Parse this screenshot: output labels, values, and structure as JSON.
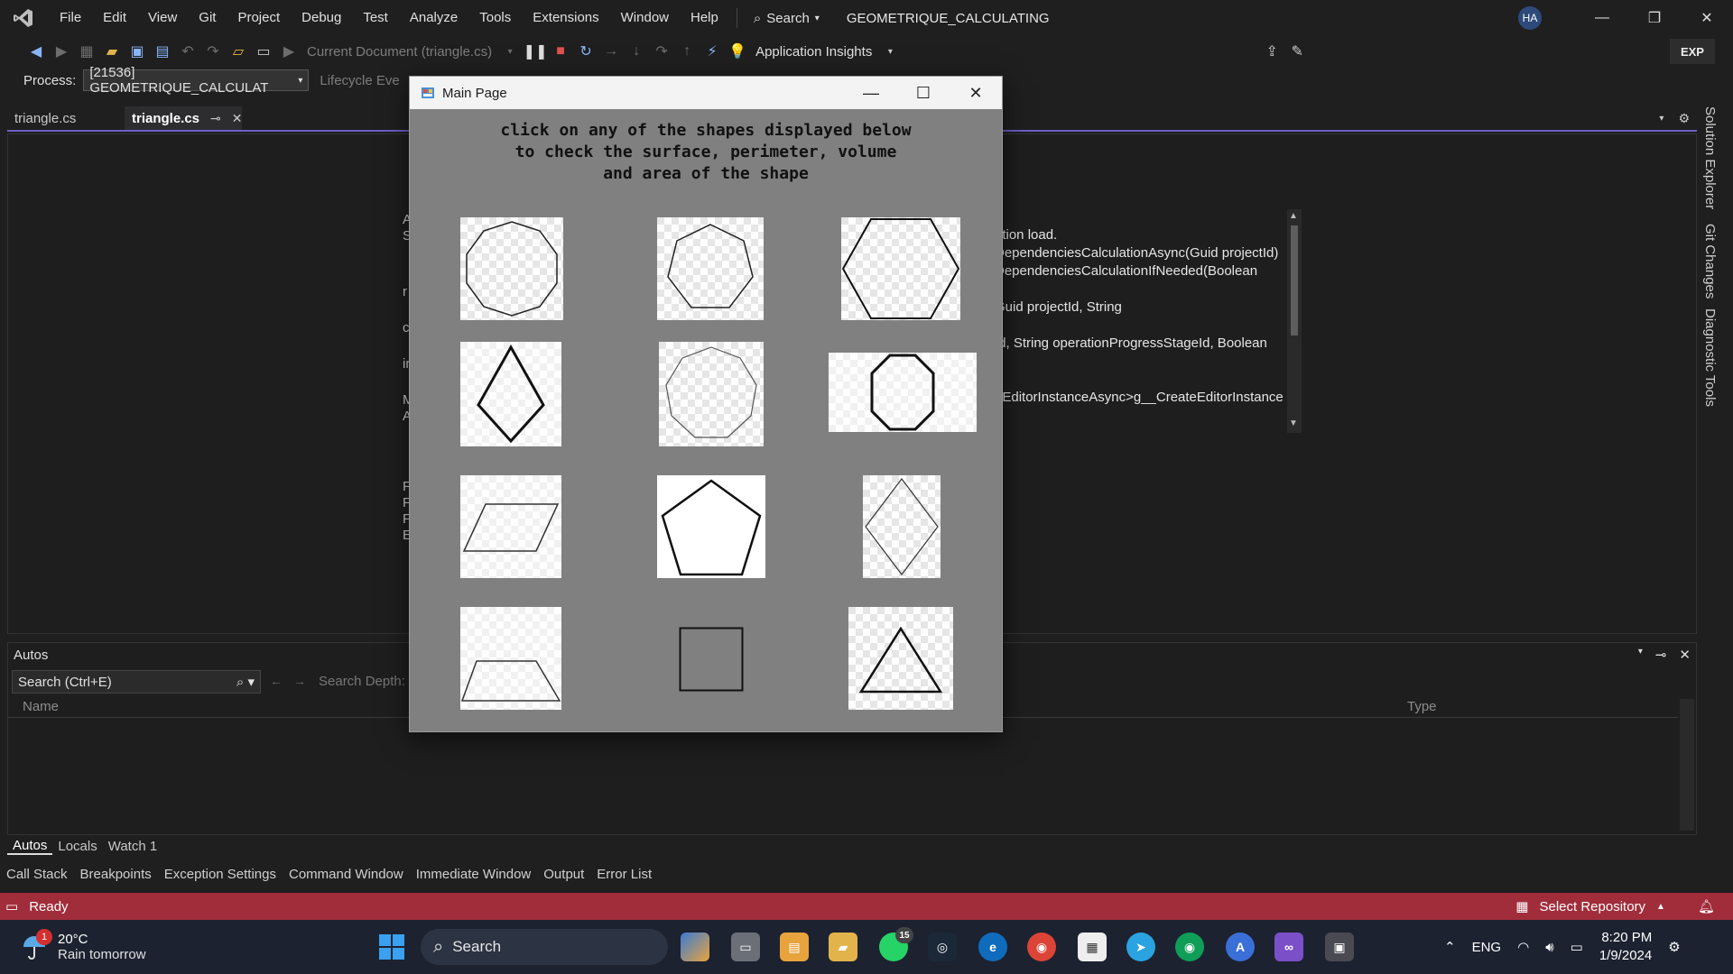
{
  "menu": {
    "items": [
      "File",
      "Edit",
      "View",
      "Git",
      "Project",
      "Debug",
      "Test",
      "Analyze",
      "Tools",
      "Extensions",
      "Window",
      "Help"
    ],
    "search_label": "Search",
    "app_title": "GEOMETRIQUE_CALCULATING",
    "avatar_initials": "HA"
  },
  "toolbar": {
    "run_target": "Current Document (triangle.cs)",
    "insights": "Application Insights",
    "exp_label": "EXP"
  },
  "process": {
    "label": "Process:",
    "value": "[21536] GEOMETRIQUE_CALCULAT",
    "lifecycle": "Lifecycle Eve"
  },
  "tabs": [
    {
      "label": "triangle.cs",
      "active": false
    },
    {
      "label": "triangle.cs",
      "active": true
    }
  ],
  "editor": {
    "gutter_letters": [
      "A",
      "S",
      "r",
      "c",
      "ir",
      "M",
      "A",
      "F",
      "F",
      "F",
      "E"
    ]
  },
  "code_popup": {
    "lines": [
      "ation load.",
      "DependenciesCalculationAsync(Guid projectId)",
      "DependenciesCalculationIfNeeded(Boolean",
      "Guid projectId, String",
      "Id, String operationProgressStageId, Boolean",
      "eEditorInstanceAsync>g__CreateEditorInstance"
    ]
  },
  "side_tabs": [
    "Solution Explorer",
    "Git Changes",
    "Diagnostic Tools"
  ],
  "autos": {
    "title": "Autos",
    "search_placeholder": "Search (Ctrl+E)",
    "search_depth": "Search Depth:",
    "col_name": "Name",
    "col_type": "Type",
    "tabs": [
      "Autos",
      "Locals",
      "Watch 1"
    ]
  },
  "bottom_tabs": [
    "Call Stack",
    "Breakpoints",
    "Exception Settings",
    "Command Window",
    "Immediate Window",
    "Output",
    "Error List"
  ],
  "status": {
    "ready": "Ready",
    "repo": "Select Repository"
  },
  "taskbar": {
    "temp": "20°C",
    "forecast": "Rain tomorrow",
    "weather_badge": "1",
    "search_label": "Search",
    "whatsapp_badge": "15",
    "lang": "ENG",
    "time": "8:20 PM",
    "date": "1/9/2024"
  },
  "dialog": {
    "title": "Main Page",
    "instructions": [
      "click on any of the shapes displayed below",
      "to check the surface, perimeter, volume",
      "and area of the shape"
    ]
  },
  "colors": {
    "status_bar": "#a12d3b",
    "accent": "#6c5fc7",
    "dialog_bg": "#808080"
  }
}
